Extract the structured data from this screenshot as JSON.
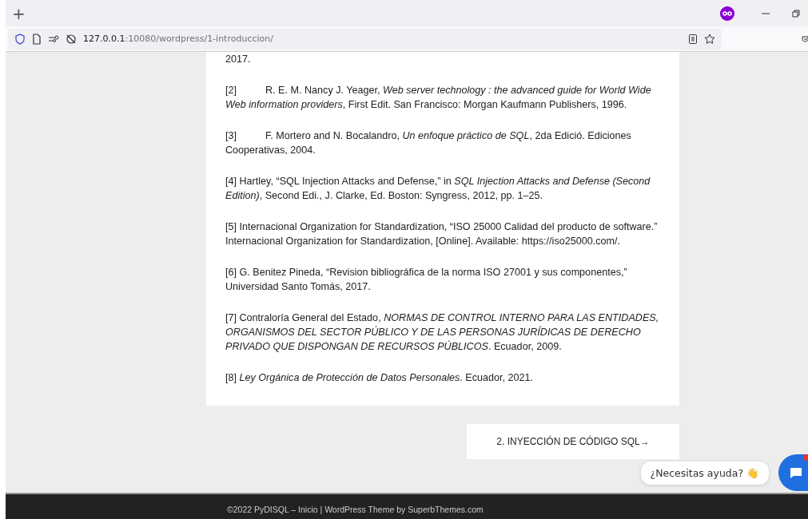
{
  "browser": {
    "new_tab": "+",
    "url_host": "127.0.0.1",
    "url_rest": ":10080/wordpress/1-introduccion/"
  },
  "article": {
    "cut_line": "2017.",
    "references": [
      {
        "label": "[2]",
        "tabbed": true,
        "text": "R. E. M. Nancy J. Yeager, *Web server technology : the advanced guide for World Wide Web information providers*, First Edit. San Francisco: Morgan Kaufmann Publishers, 1996."
      },
      {
        "label": "[3]",
        "tabbed": true,
        "text": "F. Mortero and N. Bocalandro, *Un enfoque práctico de SQL*, 2da Edició. Ediciones Cooperativas, 2004."
      },
      {
        "label": "[4]",
        "tabbed": false,
        "text": "Hartley, “SQL Injection Attacks and Defense,” in *SQL Injection Attacks and Defense (Second Edition)*, Second Edi., J. Clarke, Ed. Boston: Syngress, 2012, pp. 1–25."
      },
      {
        "label": "[5]",
        "tabbed": false,
        "text": "Internacional Organization for Standardization, “ISO 25000 Calidad del producto de software.” Internacional Organization for Standardization, [Online]. Available: https://iso25000.com/."
      },
      {
        "label": "[6]",
        "tabbed": false,
        "text": "G. Benitez Pineda, “Revision bibliográfica de la norma ISO 27001 y sus componentes,” Universidad Santo Tomás, 2017."
      },
      {
        "label": "[7]",
        "tabbed": false,
        "text": "Contraloría General del Estado, *NORMAS DE CONTROL INTERNO PARA LAS ENTIDADES, ORGANISMOS DEL SECTOR PÚBLICO Y DE LAS PERSONAS JURÍDICAS DE DERECHO PRIVADO QUE DISPONGAN DE RECURSOS PÚBLICOS*. Ecuador, 2009."
      },
      {
        "label": "[8]",
        "tabbed": false,
        "text": "*Ley Orgánica de Protección de Datos Personales*. Ecuador, 2021."
      }
    ]
  },
  "next_link": "2. INYECCIÓN DE CÓDIGO SQL→",
  "chat": {
    "bubble": "¿Necesitas ayuda?",
    "wave": "👋"
  },
  "footer": "©2022 PyDISQL – Inicio | WordPress Theme by SuperbThemes.com"
}
